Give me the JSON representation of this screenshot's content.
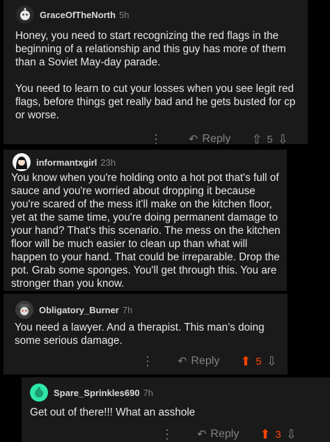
{
  "comments": [
    {
      "username": "GraceOfTheNorth",
      "time": "5h",
      "paragraphs": [
        "Honey, you need to start recognizing the red flags in the beginning of a relationship and this guy has more of them than a Soviet May-day parade.",
        "You need to learn to cut your losses when you see legit red flags, before things get really bad and he gets busted for cp or worse."
      ],
      "reply_label": "Reply",
      "score": "5",
      "upvoted": false,
      "avatar_color": "#2a2a2a"
    },
    {
      "username": "informantxgirl",
      "time": "23h",
      "paragraphs": [
        "You know when you're holding onto a hot pot that's full of sauce and you're worried about dropping it because you're scared of the mess it'll make on the kitchen floor, yet at the same time, you're doing permanent damage to your hand? That's this scenario. The mess on the kitchen floor will be much easier to clean up than what will happen to your hand. That could be irreparable. Drop the pot. Grab some sponges. You'll get through this. You are stronger than you know."
      ],
      "avatar_color": "#f3f3f3"
    },
    {
      "username": "Obligatory_Burner",
      "time": "7h",
      "paragraphs": [
        "You need a lawyer. And a therapist. This man’s doing some serious damage."
      ],
      "reply_label": "Reply",
      "score": "5",
      "upvoted": true,
      "avatar_color": "#3a3a3a"
    },
    {
      "username": "Spare_Sprinkles690",
      "time": "7h",
      "paragraphs": [
        "Get out of there!!! What an asshole"
      ],
      "reply_label": "Reply",
      "score": "3",
      "upvoted": true,
      "avatar_color": "#2ee6a6"
    }
  ],
  "colors": {
    "upvote_accent": "#ff4500",
    "card_bg": "#1a1a1b",
    "meta_gray": "#818384"
  },
  "icons": {
    "more": "more-options-icon",
    "reply": "reply-arrow-icon",
    "upvote": "upvote-arrow-icon",
    "downvote": "downvote-arrow-icon"
  }
}
